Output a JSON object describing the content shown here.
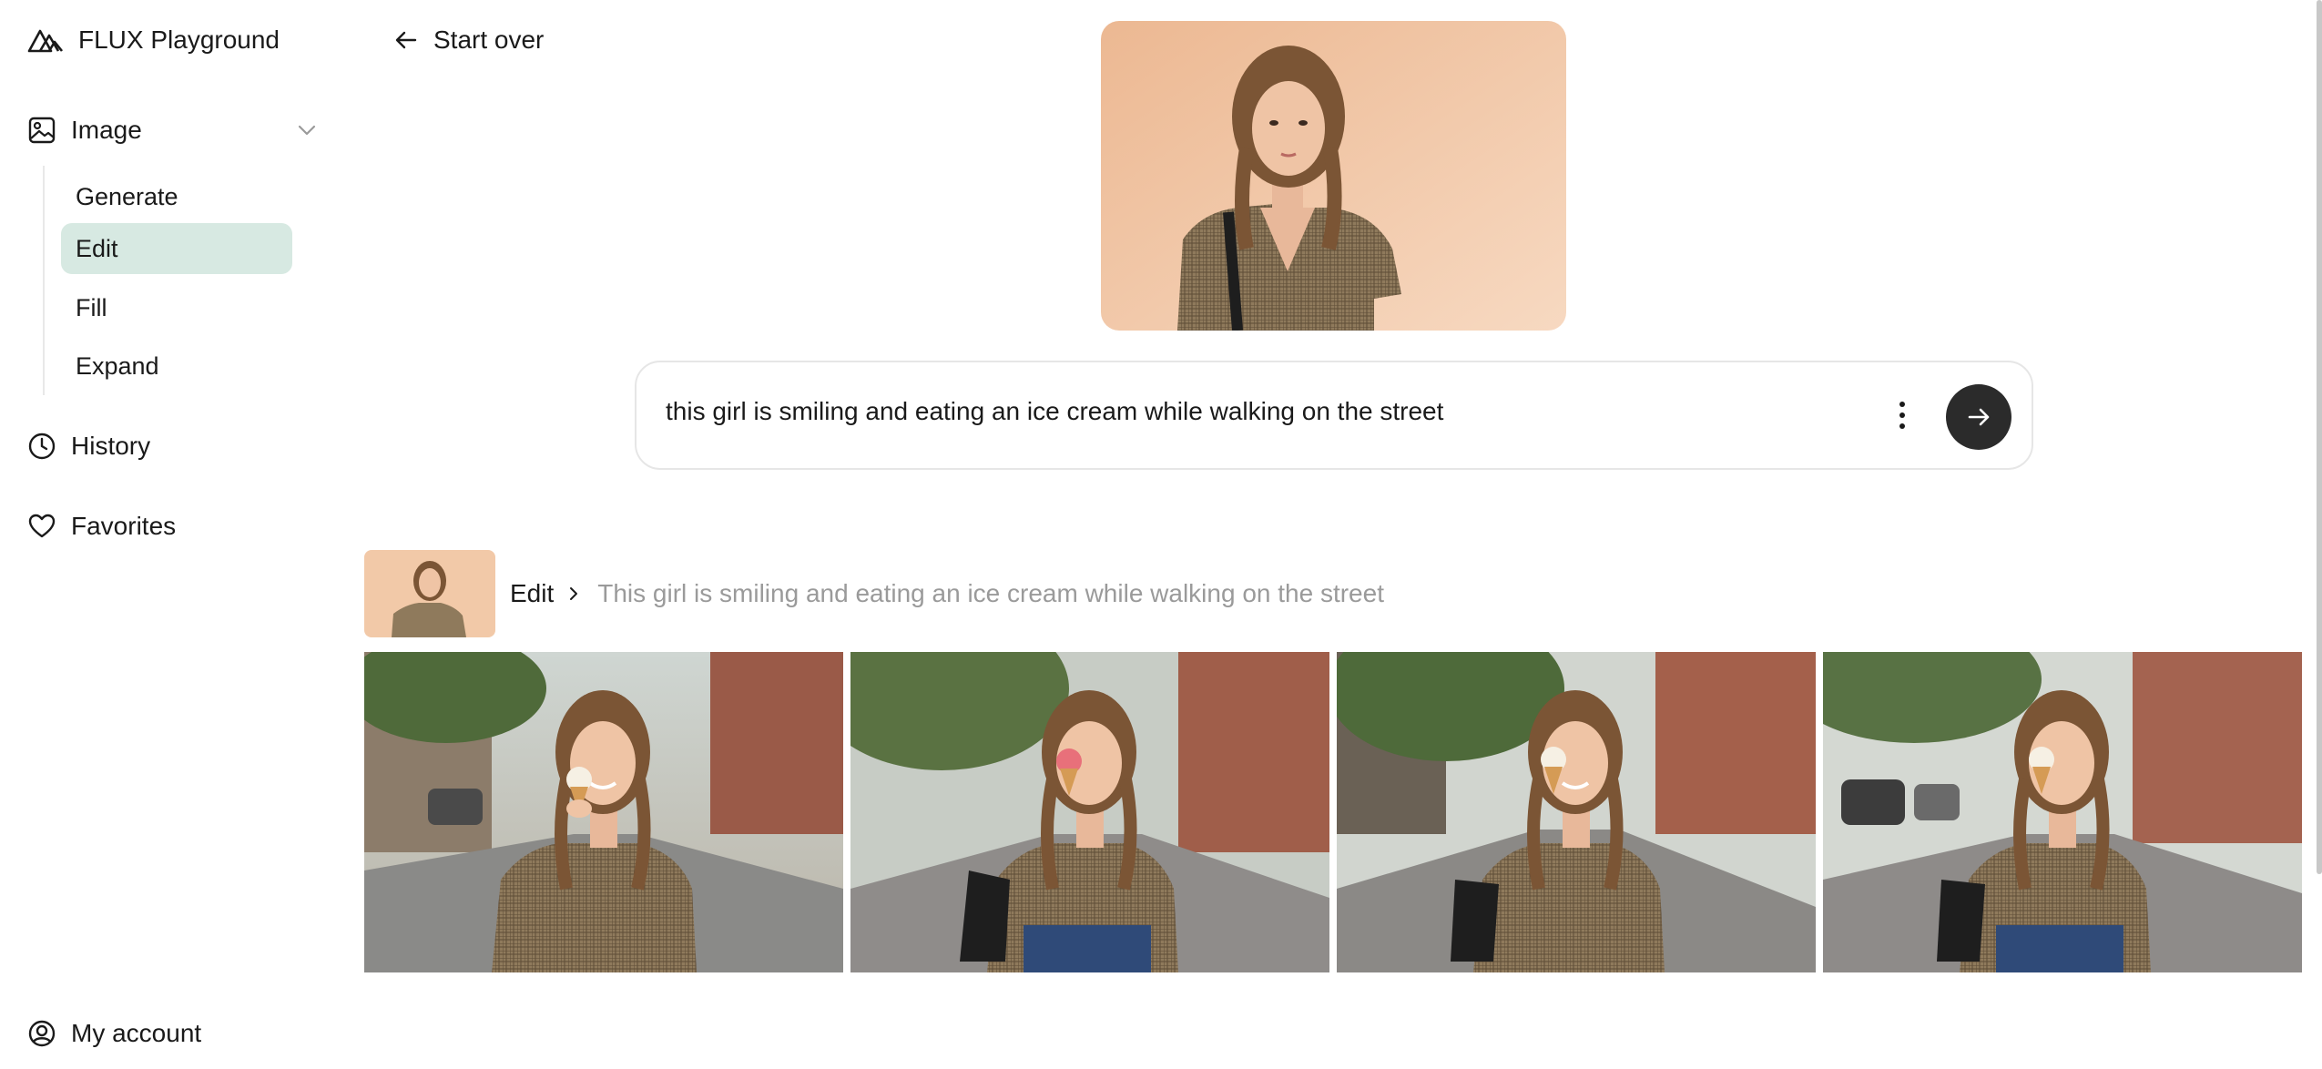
{
  "app": {
    "title": "FLUX Playground"
  },
  "sidebar": {
    "image_group": {
      "label": "Image",
      "icon": "image-icon",
      "expanded": true
    },
    "sub_items": [
      {
        "label": "Generate",
        "active": false
      },
      {
        "label": "Edit",
        "active": true
      },
      {
        "label": "Fill",
        "active": false
      },
      {
        "label": "Expand",
        "active": false
      }
    ],
    "history": {
      "label": "History",
      "icon": "clock-icon"
    },
    "favorites": {
      "label": "Favorites",
      "icon": "heart-icon"
    },
    "account": {
      "label": "My account",
      "icon": "user-circle-icon"
    }
  },
  "header": {
    "back_label": "Start over"
  },
  "prompt": {
    "value": "this girl is smiling and eating an ice cream while walking on the street"
  },
  "history_entry": {
    "mode": "Edit",
    "prompt": "This girl is smiling and eating an ice cream while walking on the street"
  },
  "results": [
    {
      "ice_cream": "#f6f0e4"
    },
    {
      "ice_cream": "#e8707a"
    },
    {
      "ice_cream": "#f6f0e4"
    },
    {
      "ice_cream": "#f6f0e4"
    }
  ],
  "colors": {
    "accent_active": "#d7e9e2",
    "send_button": "#2b2b2b",
    "muted_text": "#9a9a9a"
  }
}
